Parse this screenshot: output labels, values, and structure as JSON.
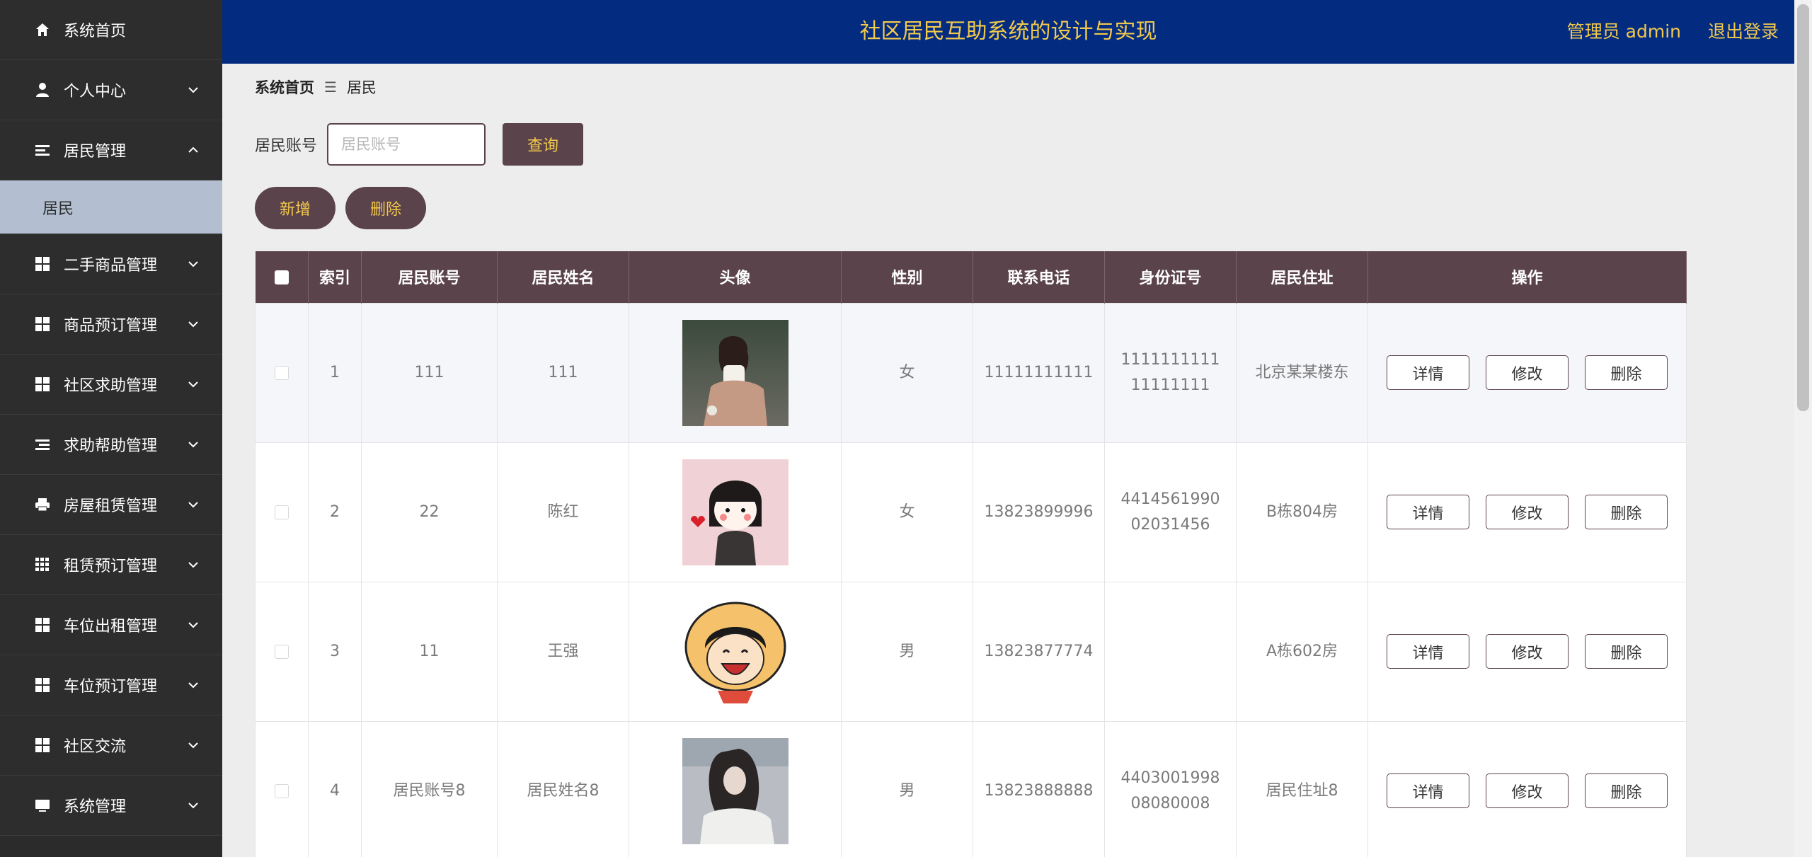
{
  "app": {
    "title": "社区居民互助系统的设计与实现",
    "user_label": "管理员 admin",
    "logout_label": "退出登录"
  },
  "sidebar": {
    "items": [
      {
        "label": "系统首页",
        "icon": "home-icon"
      },
      {
        "label": "个人中心",
        "icon": "user-icon"
      },
      {
        "label": "居民管理",
        "icon": "list-icon",
        "expanded": true
      },
      {
        "label": "二手商品管理",
        "icon": "grid-icon"
      },
      {
        "label": "商品预订管理",
        "icon": "grid-icon"
      },
      {
        "label": "社区求助管理",
        "icon": "grid-icon"
      },
      {
        "label": "求助帮助管理",
        "icon": "list-icon"
      },
      {
        "label": "房屋租赁管理",
        "icon": "printer-icon"
      },
      {
        "label": "租赁预订管理",
        "icon": "apps-icon"
      },
      {
        "label": "车位出租管理",
        "icon": "grid-icon"
      },
      {
        "label": "车位预订管理",
        "icon": "grid-icon"
      },
      {
        "label": "社区交流",
        "icon": "grid-icon"
      },
      {
        "label": "系统管理",
        "icon": "monitor-icon"
      }
    ],
    "submenu": {
      "label": "居民"
    }
  },
  "breadcrumb": {
    "home": "系统首页",
    "current": "居民"
  },
  "search": {
    "label": "居民账号",
    "placeholder": "居民账号",
    "value": "",
    "query_label": "查询"
  },
  "actions": {
    "add_label": "新增",
    "delete_label": "删除"
  },
  "table": {
    "columns": [
      "索引",
      "居民账号",
      "居民姓名",
      "头像",
      "性别",
      "联系电话",
      "身份证号",
      "居民住址",
      "操作"
    ],
    "rows": [
      {
        "index": "1",
        "account": "111",
        "name": "111",
        "gender": "女",
        "phone": "11111111111",
        "id_card": "111111111111111111",
        "address": "北京某某楼东",
        "avatar": "photo-woman-sitting"
      },
      {
        "index": "2",
        "account": "22",
        "name": "陈红",
        "gender": "女",
        "phone": "13823899996",
        "id_card": "441456199002031456",
        "address": "B栋804房",
        "avatar": "cartoon-girl"
      },
      {
        "index": "3",
        "account": "11",
        "name": "王强",
        "gender": "男",
        "phone": "13823877774",
        "id_card": "",
        "address": "A栋602房",
        "avatar": "cartoon-boy-strawhat"
      },
      {
        "index": "4",
        "account": "居民账号8",
        "name": "居民姓名8",
        "gender": "男",
        "phone": "13823888888",
        "id_card": "440300199808080008",
        "address": "居民住址8",
        "avatar": "photo-woman-hair"
      }
    ],
    "op_labels": {
      "detail": "详情",
      "edit": "修改",
      "delete": "删除"
    }
  },
  "colors": {
    "sidebar_bg": "#2d2d2d",
    "header_bg": "#032c80",
    "accent": "#5b434b",
    "header_text": "#f2c94c",
    "submenu_active": "#b3bfd0"
  }
}
